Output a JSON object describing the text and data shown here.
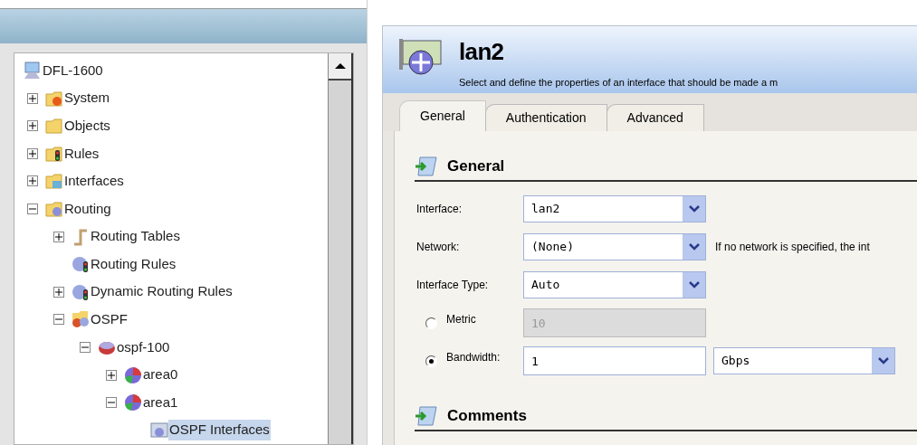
{
  "tree": [
    {
      "label": "DFL-1600",
      "kind": "computer",
      "selected": false,
      "children": [
        {
          "label": "System",
          "kind": "folder-gear",
          "expanded": false,
          "selected": false
        },
        {
          "label": "Objects",
          "kind": "folder",
          "expanded": false,
          "selected": false
        },
        {
          "label": "Rules",
          "kind": "folder-lights",
          "expanded": false,
          "selected": false
        },
        {
          "label": "Interfaces",
          "kind": "folder-network",
          "expanded": false,
          "selected": false
        },
        {
          "label": "Routing",
          "kind": "folder-routing",
          "expanded": true,
          "selected": false,
          "children": [
            {
              "label": "Routing Tables",
              "kind": "pipe",
              "expanded": false,
              "selected": false
            },
            {
              "label": "Routing Rules",
              "kind": "router-lights",
              "selected": false
            },
            {
              "label": "Dynamic Routing Rules",
              "kind": "router-lights",
              "expanded": false,
              "selected": false
            },
            {
              "label": "OSPF",
              "kind": "ospf",
              "expanded": true,
              "selected": false,
              "children": [
                {
                  "label": "ospf-100",
                  "kind": "router",
                  "expanded": true,
                  "selected": false,
                  "children": [
                    {
                      "label": "area0",
                      "kind": "area",
                      "expanded": false,
                      "selected": false
                    },
                    {
                      "label": "area1",
                      "kind": "area",
                      "expanded": true,
                      "selected": false,
                      "children": [
                        {
                          "label": "OSPF Interfaces",
                          "kind": "interface",
                          "selected": true
                        }
                      ]
                    }
                  ]
                }
              ]
            }
          ]
        }
      ]
    }
  ],
  "header": {
    "title": "lan2",
    "description": "Select and define the properties of an interface that should be made a m"
  },
  "tabs": [
    {
      "label": "General",
      "selected": true
    },
    {
      "label": "Authentication",
      "selected": false
    },
    {
      "label": "Advanced",
      "selected": false
    }
  ],
  "sections": [
    {
      "title": "General"
    },
    {
      "title": "Comments"
    }
  ],
  "fields": [
    {
      "kind": "select",
      "label": "Interface:",
      "value": "lan2"
    },
    {
      "kind": "select",
      "label": "Network:",
      "value": "(None)",
      "note": "If no network is specified, the int"
    },
    {
      "kind": "select",
      "label": "Interface Type:",
      "value": "Auto"
    },
    {
      "kind": "radio-text",
      "label": "Metric",
      "value": "10",
      "checked": false,
      "disabled": true
    },
    {
      "kind": "radio-text-select",
      "label": "Bandwidth:",
      "value": "1",
      "checked": true,
      "disabled": false,
      "unit": "Gbps"
    }
  ]
}
